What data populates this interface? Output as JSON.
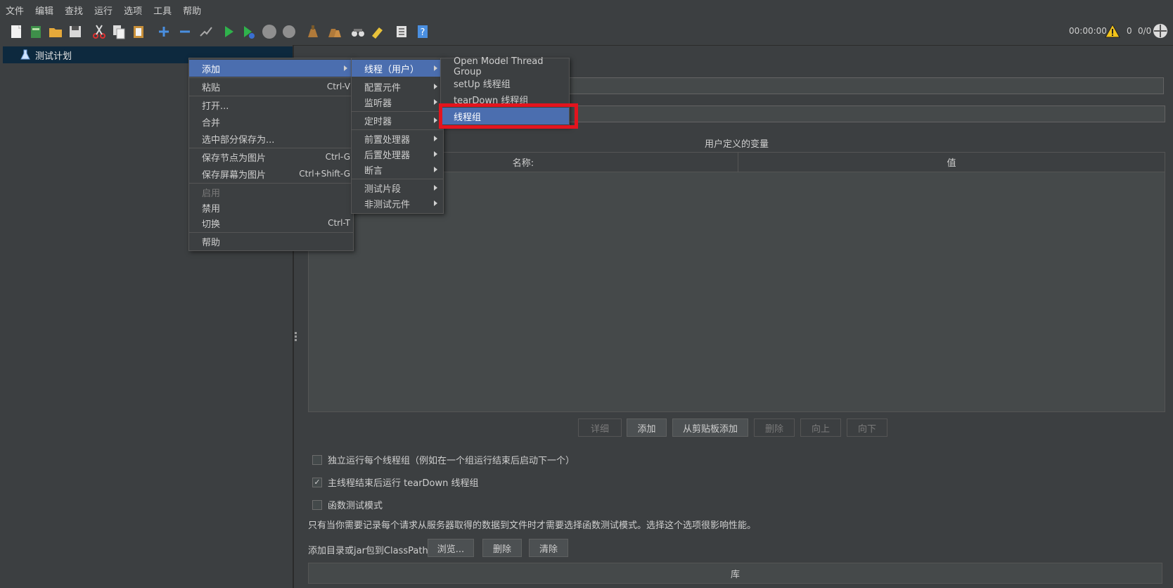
{
  "menubar": [
    "文件",
    "编辑",
    "查找",
    "运行",
    "选项",
    "工具",
    "帮助"
  ],
  "status": {
    "timer": "00:00:00",
    "warnings": "0",
    "threads": "0/0"
  },
  "tree": {
    "root": "测试计划"
  },
  "menu1": {
    "items": [
      {
        "label": "添加",
        "shortcut": ""
      },
      {
        "label": "粘贴",
        "shortcut": "Ctrl-V"
      },
      {
        "label": "打开...",
        "shortcut": ""
      },
      {
        "label": "合并",
        "shortcut": ""
      },
      {
        "label": "选中部分保存为...",
        "shortcut": ""
      },
      {
        "label": "保存节点为图片",
        "shortcut": "Ctrl-G"
      },
      {
        "label": "保存屏幕为图片",
        "shortcut": "Ctrl+Shift-G"
      },
      {
        "label": "启用",
        "shortcut": ""
      },
      {
        "label": "禁用",
        "shortcut": ""
      },
      {
        "label": "切换",
        "shortcut": "Ctrl-T"
      },
      {
        "label": "帮助",
        "shortcut": ""
      }
    ]
  },
  "menu2": {
    "items": [
      "线程（用户）",
      "配置元件",
      "监听器",
      "定时器",
      "前置处理器",
      "后置处理器",
      "断言",
      "测试片段",
      "非测试元件"
    ]
  },
  "menu3": {
    "items": [
      "Open Model Thread Group",
      "setUp 线程组",
      "tearDown 线程组",
      "线程组"
    ]
  },
  "panel": {
    "section_title": "用户定义的变量",
    "col_name": "名称:",
    "col_value": "值",
    "buttons": [
      "详细",
      "添加",
      "从剪贴板添加",
      "删除",
      "向上",
      "向下"
    ],
    "checkboxes": [
      {
        "label": "独立运行每个线程组（例如在一个组运行结束后启动下一个）",
        "checked": false
      },
      {
        "label": "主线程结束后运行 tearDown 线程组",
        "checked": true
      },
      {
        "label": "函数测试模式",
        "checked": false
      }
    ],
    "note": "只有当你需要记录每个请求从服务器取得的数据到文件时才需要选择函数测试模式。选择这个选项很影响性能。",
    "classpath_label": "添加目录或jar包到ClassPath",
    "classpath_buttons": [
      "浏览...",
      "删除",
      "清除"
    ],
    "library_header": "库"
  }
}
